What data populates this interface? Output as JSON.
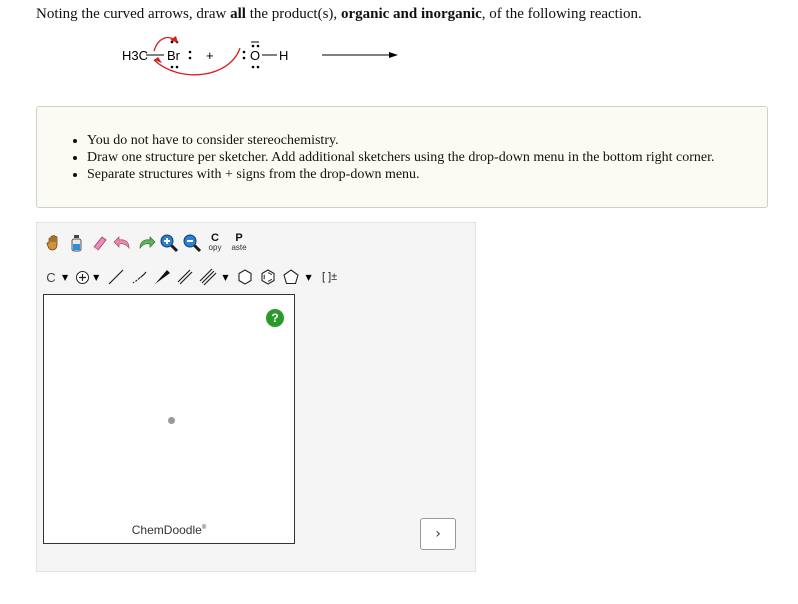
{
  "question": {
    "prefix": "Noting the curved arrows, draw ",
    "bold1": "all",
    "middle": " the product(s), ",
    "bold2": "organic and inorganic",
    "suffix": ", of the following reaction."
  },
  "reaction": {
    "methyl": "H3C",
    "bromine": "Br",
    "plus": "+",
    "oxygen": "O",
    "hydrogen": "H"
  },
  "instructions": [
    "You do not have to consider stereochemistry.",
    "Draw one structure per sketcher. Add additional sketchers using the drop-down menu in the bottom right corner.",
    "Separate structures with + signs from the drop-down menu."
  ],
  "toolbar": {
    "copy_big": "C",
    "copy_small": "opy",
    "paste_big": "P",
    "paste_small": "aste",
    "atom_label": "C",
    "charge_label": "[ ]±"
  },
  "canvas": {
    "help_label": "?",
    "brand": "ChemDoodle",
    "brand_mark": "®"
  },
  "adder": {
    "label": "›"
  }
}
